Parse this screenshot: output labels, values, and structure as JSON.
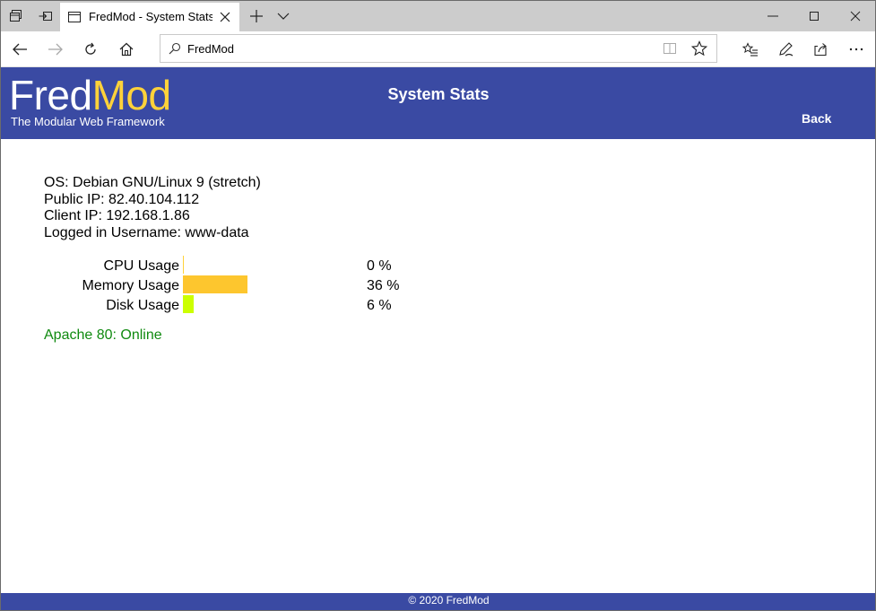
{
  "browser": {
    "tab_title": "FredMod - System Stats",
    "address": "FredMod"
  },
  "header": {
    "logo_part1": "Fred",
    "logo_part2": "Mod",
    "tagline": "The Modular Web Framework",
    "title": "System Stats",
    "back_label": "Back"
  },
  "info": {
    "os": "OS: Debian GNU/Linux 9 (stretch)",
    "public_ip": "Public IP: 82.40.104.112",
    "client_ip": "Client IP: 192.168.1.86",
    "username": "Logged in Username: www-data"
  },
  "stats": [
    {
      "label": "CPU Usage",
      "value_text": "0 %",
      "percent": 0,
      "color": "#ffd23a"
    },
    {
      "label": "Memory Usage",
      "value_text": "36 %",
      "percent": 36,
      "color": "#fdc62e"
    },
    {
      "label": "Disk Usage",
      "value_text": "6 %",
      "percent": 6,
      "color": "#ccff00"
    }
  ],
  "service": {
    "text": "Apache 80: Online",
    "color": "#108a10"
  },
  "footer": {
    "text": "© 2020 FredMod"
  },
  "colors": {
    "brand": "#3a4aa3",
    "accent": "#ffd23a"
  },
  "icons": {
    "tab_actions": "tab-actions-icon",
    "set_aside": "set-aside-tabs-icon",
    "tab_page": "tab-page-icon",
    "close": "close-icon",
    "new_tab": "plus-icon",
    "tab_list": "chevron-down-icon",
    "minimize": "minimize-icon",
    "maximize": "maximize-icon",
    "window_close": "window-close-icon",
    "back": "back-arrow-icon",
    "forward": "forward-arrow-icon",
    "refresh": "refresh-icon",
    "home": "home-icon",
    "search": "search-icon",
    "reading_view": "reading-view-icon",
    "favorite": "star-icon",
    "favorites": "favorites-icon",
    "notes": "pen-icon",
    "share": "share-icon",
    "more": "more-icon"
  }
}
